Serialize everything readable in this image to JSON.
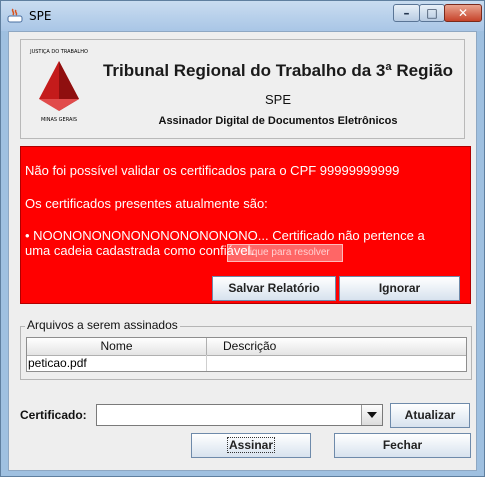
{
  "window": {
    "title": "SPE",
    "minimize_label": "–",
    "maximize_label": "□",
    "close_label": "✕"
  },
  "header": {
    "logo_top_text": "JUSTIÇA DO TRABALHO",
    "logo_bottom_text": "MINAS GERAIS",
    "title": "Tribunal Regional do Trabalho da 3ª Região",
    "subtitle": "SPE",
    "description": "Assinador Digital de Documentos Eletrônicos"
  },
  "alert": {
    "background_color": "#ff0000",
    "line1": "Não foi possível validar os certificados para o CPF 99999999999",
    "line2": "Os certificados presentes atualmente são:",
    "line3": "• NOONONONONONONONONONONO... Certificado não pertence a",
    "line4": "uma cadeia cadastrada como confiável.",
    "tooltip": "Clique para resolver",
    "save_report_label": "Salvar Relatório",
    "ignore_label": "Ignorar"
  },
  "files": {
    "group_label": "Arquivos a serem assinados",
    "columns": [
      "Nome",
      "Descrição"
    ],
    "rows": [
      {
        "name": "peticao.pdf",
        "description": ""
      }
    ]
  },
  "certificate": {
    "label": "Certificado:",
    "selected": "",
    "update_label": "Atualizar"
  },
  "actions": {
    "sign_label": "Assinar",
    "close_label": "Fechar"
  }
}
